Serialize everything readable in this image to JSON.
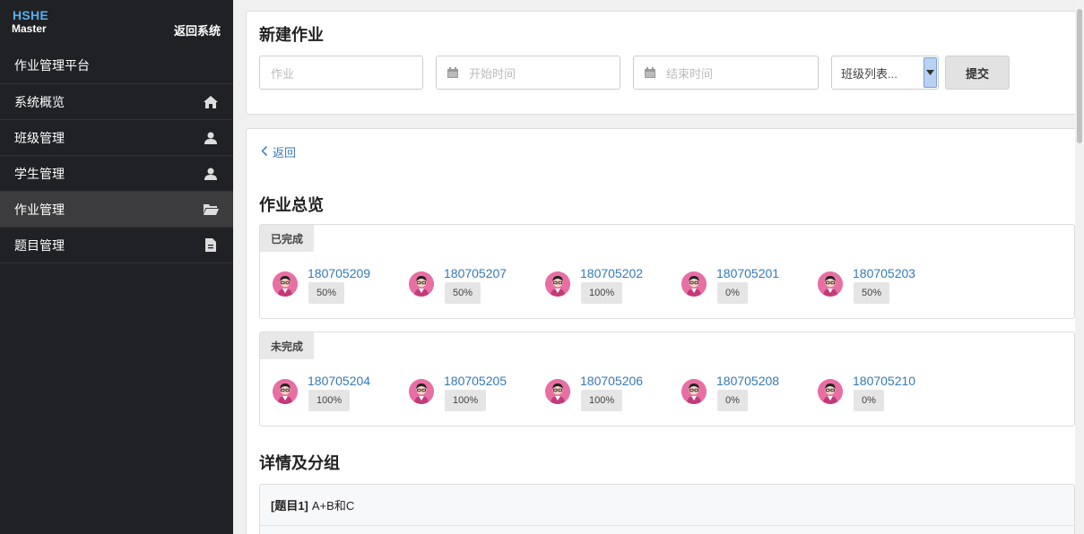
{
  "sidebar": {
    "brand_line1": "HSHE",
    "brand_line2": "Master",
    "back_system": "返回系统",
    "platform": "作业管理平台",
    "items": [
      {
        "label": "系统概览",
        "icon": "home-icon"
      },
      {
        "label": "班级管理",
        "icon": "user-icon"
      },
      {
        "label": "学生管理",
        "icon": "user-icon"
      },
      {
        "label": "作业管理",
        "icon": "folder-open-icon",
        "active": true
      },
      {
        "label": "题目管理",
        "icon": "file-icon"
      }
    ]
  },
  "new_homework": {
    "title": "新建作业",
    "name_placeholder": "作业",
    "start_placeholder": "开始时间",
    "end_placeholder": "结束时间",
    "class_select": "班级列表...",
    "submit_label": "提交"
  },
  "overview": {
    "back_label": "返回",
    "title": "作业总览",
    "completed": {
      "label": "已完成",
      "students": [
        {
          "id": "180705209",
          "pct": "50%"
        },
        {
          "id": "180705207",
          "pct": "50%"
        },
        {
          "id": "180705202",
          "pct": "100%"
        },
        {
          "id": "180705201",
          "pct": "0%"
        },
        {
          "id": "180705203",
          "pct": "50%"
        }
      ]
    },
    "incomplete": {
      "label": "未完成",
      "students": [
        {
          "id": "180705204",
          "pct": "100%"
        },
        {
          "id": "180705205",
          "pct": "100%"
        },
        {
          "id": "180705206",
          "pct": "100%"
        },
        {
          "id": "180705208",
          "pct": "0%"
        },
        {
          "id": "180705210",
          "pct": "0%"
        }
      ]
    }
  },
  "details": {
    "title": "详情及分组",
    "question_tag": "[题目1]",
    "question_title": "A+B和C"
  },
  "colors": {
    "sidebar_bg": "#1f2124",
    "accent_blue": "#337ab7",
    "avatar_pink": "#e86fa3"
  }
}
